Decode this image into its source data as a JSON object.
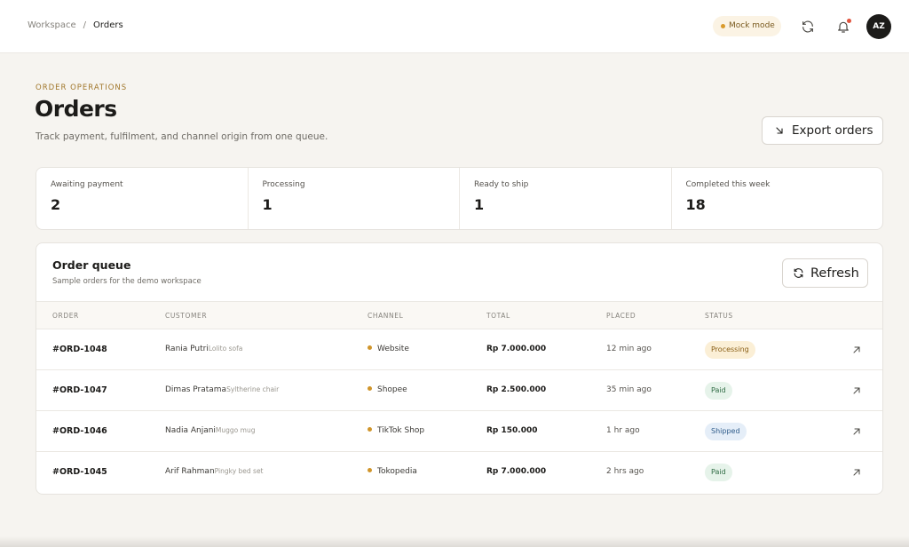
{
  "breadcrumb": {
    "root": "Workspace",
    "separator": "/",
    "current": "Orders"
  },
  "topbar": {
    "mode_label": "Mock mode",
    "avatar_initials": "AZ"
  },
  "header": {
    "eyebrow": "ORDER OPERATIONS",
    "title": "Orders",
    "subtitle": "Track payment, fulfilment, and channel origin from one queue.",
    "export_label": "Export orders"
  },
  "stats": [
    {
      "label": "Awaiting payment",
      "value": "2"
    },
    {
      "label": "Processing",
      "value": "1"
    },
    {
      "label": "Ready to ship",
      "value": "1"
    },
    {
      "label": "Completed this week",
      "value": "18"
    }
  ],
  "queue": {
    "title": "Order queue",
    "subtitle": "Sample orders for the demo workspace",
    "refresh_label": "Refresh",
    "columns": [
      "ORDER",
      "CUSTOMER",
      "CHANNEL",
      "TOTAL",
      "PLACED",
      "STATUS"
    ],
    "rows": [
      {
        "id": "#ORD-1048",
        "customer": "Rania Putri",
        "item": "Lolito sofa",
        "channel": "Website",
        "total": "Rp 7.000.000",
        "placed": "12 min ago",
        "status": "Processing",
        "status_kind": "processing"
      },
      {
        "id": "#ORD-1047",
        "customer": "Dimas Pratama",
        "item": "Syltherine chair",
        "channel": "Shopee",
        "total": "Rp 2.500.000",
        "placed": "35 min ago",
        "status": "Paid",
        "status_kind": "paid"
      },
      {
        "id": "#ORD-1046",
        "customer": "Nadia Anjani",
        "item": "Muggo mug",
        "channel": "TikTok Shop",
        "total": "Rp 150.000",
        "placed": "1 hr ago",
        "status": "Shipped",
        "status_kind": "shipped"
      },
      {
        "id": "#ORD-1045",
        "customer": "Arif Rahman",
        "item": "Pingky bed set",
        "channel": "Tokopedia",
        "total": "Rp 7.000.000",
        "placed": "2 hrs ago",
        "status": "Paid",
        "status_kind": "paid"
      }
    ]
  },
  "icons": {
    "sync": "sync-icon",
    "notifications": "bell-icon",
    "export": "arrow-down-right-icon",
    "refresh": "refresh-icon",
    "row_open": "arrow-up-right-icon"
  },
  "colors": {
    "accent": "#a0762a",
    "channel_dot": "#d0952b",
    "notification_dot": "#e0533d"
  }
}
